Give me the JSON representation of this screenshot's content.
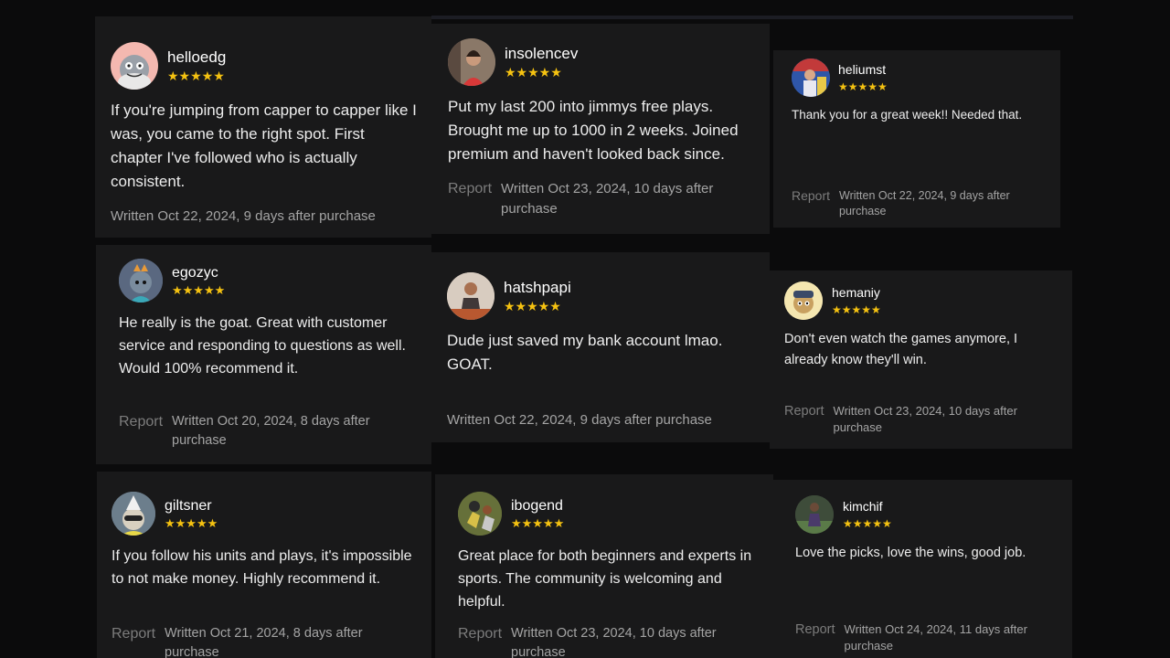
{
  "rating_stars": "★★★★★",
  "star_color": "#f5c211",
  "reviews": [
    {
      "username": "helloedg",
      "avatar_icon": "cartoon-frog-avatar-icon",
      "text": "If you're jumping from capper to capper like I was, you came to the right spot. First chapter I've followed who is actually consistent.",
      "report": "",
      "written": "Written Oct 22, 2024, 9 days after purchase"
    },
    {
      "username": "insolencev",
      "avatar_icon": "portrait-photo-avatar-icon",
      "text": "Put my last 200 into jimmys free plays. Brought me up to 1000 in 2 weeks. Joined premium and haven't looked back since.",
      "report": "Report",
      "written": "Written Oct 23, 2024, 10 days after purchase"
    },
    {
      "username": "heliumst",
      "avatar_icon": "sports-photo-avatar-icon",
      "text": "Thank you for a great week!! Needed that.",
      "report": "Report",
      "written": "Written Oct 22, 2024, 9 days after purchase"
    },
    {
      "username": "egozyc",
      "avatar_icon": "cartoon-ape-avatar-icon",
      "text": "He really is the goat. Great with customer service and responding to questions as well. Would 100% recommend it.",
      "report": "Report",
      "written": "Written Oct 20, 2024, 8 days after purchase"
    },
    {
      "username": "hatshpapi",
      "avatar_icon": "athlete-photo-avatar-icon",
      "text": "Dude just saved my bank account lmao. GOAT.",
      "report": "",
      "written": "Written Oct 22, 2024, 9 days after purchase"
    },
    {
      "username": "hemaniy",
      "avatar_icon": "cartoon-dog-avatar-icon",
      "text": "Don't even watch the games anymore, I already know they'll win.",
      "report": "Report",
      "written": "Written Oct 23, 2024, 10 days after purchase"
    },
    {
      "username": "giltsner",
      "avatar_icon": "cartoon-party-hat-avatar-icon",
      "text": "If you follow his units and plays, it's impossible to not make money. Highly recommend it.",
      "report": "Report",
      "written": "Written Oct 21, 2024, 8 days after purchase"
    },
    {
      "username": "ibogend",
      "avatar_icon": "football-photo-avatar-icon",
      "text": "Great place for both beginners and experts in sports. The community is welcoming and helpful.",
      "report": "Report",
      "written": "Written Oct 23, 2024, 10 days after purchase"
    },
    {
      "username": "kimchif",
      "avatar_icon": "field-photo-avatar-icon",
      "text": "Love the picks, love the wins, good job.",
      "report": "Report",
      "written": "Written Oct 24, 2024, 11 days after purchase"
    }
  ]
}
